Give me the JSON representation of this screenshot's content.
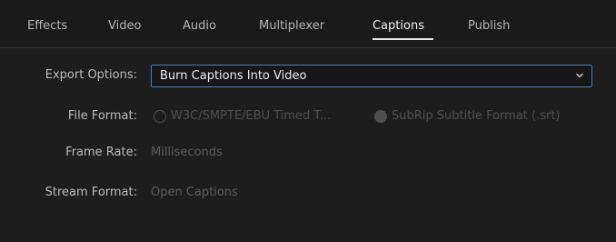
{
  "tabs": [
    {
      "label": "Effects"
    },
    {
      "label": "Video"
    },
    {
      "label": "Audio"
    },
    {
      "label": "Multiplexer"
    },
    {
      "label": "Captions",
      "active": true
    },
    {
      "label": "Publish"
    }
  ],
  "form": {
    "export_options": {
      "label": "Export Options:",
      "selected": "Burn Captions Into Video"
    },
    "file_format": {
      "label": "File Format:",
      "option_1": "W3C/SMPTE/EBU Timed T...",
      "option_2": "SubRip Subtitle Format (.srt)",
      "selected_option": 2
    },
    "frame_rate": {
      "label": "Frame Rate:",
      "value": "Milliseconds"
    },
    "stream_format": {
      "label": "Stream Format:",
      "value": "Open Captions"
    }
  },
  "colors": {
    "background": "#1d1d1d",
    "accent_border": "#3e83c5",
    "disabled_text": "#5c5c5c"
  }
}
